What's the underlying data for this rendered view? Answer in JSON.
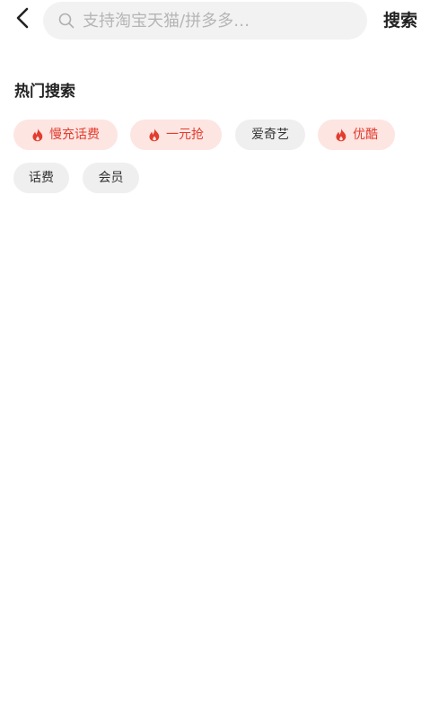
{
  "search": {
    "placeholder": "支持淘宝天猫/拼多多…",
    "button_label": "搜索"
  },
  "hot_search": {
    "title": "热门搜索",
    "tags": [
      {
        "label": "慢充话费",
        "hot": true
      },
      {
        "label": "一元抢",
        "hot": true
      },
      {
        "label": "爱奇艺",
        "hot": false
      },
      {
        "label": "优酷",
        "hot": true
      },
      {
        "label": "话费",
        "hot": false
      },
      {
        "label": "会员",
        "hot": false
      }
    ]
  },
  "colors": {
    "accent": "#e23d2e",
    "hot_tag_bg": "#fde5e2",
    "normal_tag_bg": "#efefef",
    "search_bg": "#f2f2f2"
  },
  "icons": {
    "back": "chevron-left-icon",
    "search": "search-icon",
    "hot": "fire-icon"
  }
}
